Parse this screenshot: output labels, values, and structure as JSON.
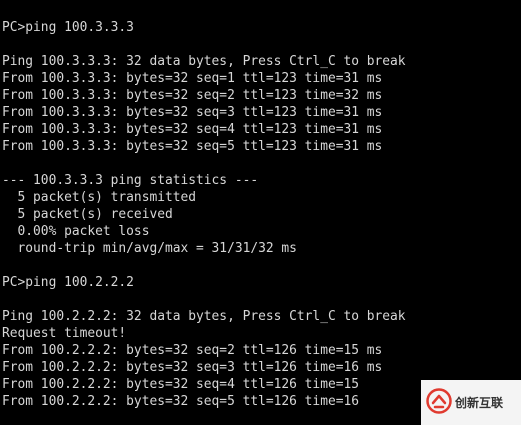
{
  "terminal": {
    "lines": [
      "PC>ping 100.3.3.3",
      "",
      "Ping 100.3.3.3: 32 data bytes, Press Ctrl_C to break",
      "From 100.3.3.3: bytes=32 seq=1 ttl=123 time=31 ms",
      "From 100.3.3.3: bytes=32 seq=2 ttl=123 time=32 ms",
      "From 100.3.3.3: bytes=32 seq=3 ttl=123 time=31 ms",
      "From 100.3.3.3: bytes=32 seq=4 ttl=123 time=31 ms",
      "From 100.3.3.3: bytes=32 seq=5 ttl=123 time=31 ms",
      "",
      "--- 100.3.3.3 ping statistics ---",
      "  5 packet(s) transmitted",
      "  5 packet(s) received",
      "  0.00% packet loss",
      "  round-trip min/avg/max = 31/31/32 ms",
      "",
      "PC>ping 100.2.2.2",
      "",
      "Ping 100.2.2.2: 32 data bytes, Press Ctrl_C to break",
      "Request timeout!",
      "From 100.2.2.2: bytes=32 seq=2 ttl=126 time=15 ms",
      "From 100.2.2.2: bytes=32 seq=3 ttl=126 time=16 ms",
      "From 100.2.2.2: bytes=32 seq=4 ttl=126 time=15",
      "From 100.2.2.2: bytes=32 seq=5 ttl=126 time=16"
    ]
  },
  "watermark": {
    "text": "创新互联",
    "color": "#e03a2f"
  },
  "colors": {
    "background": "#000000",
    "text": "#d7d7d7"
  }
}
